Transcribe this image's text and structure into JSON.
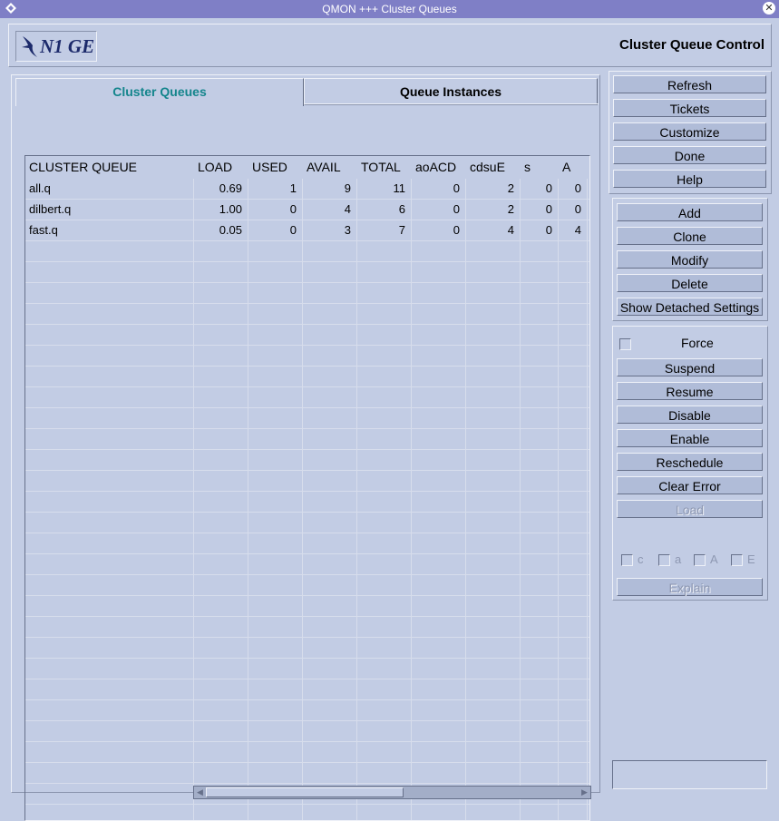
{
  "window": {
    "title": "QMON +++ Cluster Queues",
    "close_label": "✕"
  },
  "header": {
    "logo_text": "N1 GE",
    "heading": "Cluster Queue Control"
  },
  "tabs": [
    {
      "label": "Cluster Queues",
      "active": true
    },
    {
      "label": "Queue Instances",
      "active": false
    }
  ],
  "table": {
    "columns": [
      "CLUSTER QUEUE",
      "LOAD",
      "USED",
      "AVAIL",
      "TOTAL",
      "aoACD",
      "cdsuE",
      "s",
      "A"
    ],
    "rows": [
      [
        "all.q",
        "0.69",
        "1",
        "9",
        "11",
        "0",
        "2",
        "0",
        "0"
      ],
      [
        "dilbert.q",
        "1.00",
        "0",
        "4",
        "6",
        "0",
        "2",
        "0",
        "0"
      ],
      [
        "fast.q",
        "0.05",
        "0",
        "3",
        "7",
        "0",
        "4",
        "0",
        "4"
      ]
    ]
  },
  "buttons_top": [
    "Refresh",
    "Tickets",
    "Customize",
    "Done",
    "Help"
  ],
  "buttons_mid": [
    "Add",
    "Clone",
    "Modify",
    "Delete",
    "Show Detached Settings"
  ],
  "force_label": "Force",
  "buttons_actions": [
    "Suspend",
    "Resume",
    "Disable",
    "Enable",
    "Reschedule",
    "Clear Error"
  ],
  "load_button": "Load",
  "state_checks": [
    "c",
    "a",
    "A",
    "E"
  ],
  "explain_button": "Explain",
  "colors": {
    "background": "#c2cce4",
    "titlebar": "#7f7fc6",
    "active_tab_text": "#14858c",
    "logo": "#1c2a6b"
  }
}
